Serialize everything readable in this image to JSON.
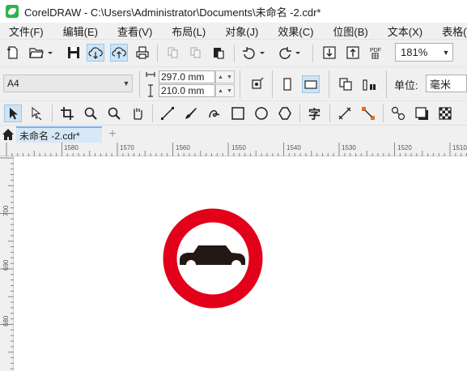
{
  "window": {
    "title": "CorelDRAW - C:\\Users\\Administrator\\Documents\\未命名 -2.cdr*"
  },
  "menu": [
    "文件(F)",
    "编辑(E)",
    "查看(V)",
    "布局(L)",
    "对象(J)",
    "效果(C)",
    "位图(B)",
    "文本(X)",
    "表格(T)"
  ],
  "standard_toolbar": {
    "zoom": "181%",
    "icons": [
      "new-document-icon",
      "open-folder-icon",
      "save-icon",
      "cloud-download-icon",
      "cloud-upload-icon",
      "print-icon",
      "cut-icon",
      "copy-icon",
      "paste-icon",
      "undo-icon",
      "redo-icon",
      "import-icon",
      "export-icon",
      "publish-pdf-icon"
    ]
  },
  "property_bar": {
    "page_size": "A4",
    "width": "297.0 mm",
    "height": "210.0 mm",
    "units_label": "单位:",
    "units": "毫米"
  },
  "toolbox_icons": [
    "pick-tool-icon",
    "shape-tool-icon",
    "crop-tool-icon",
    "zoom-tool-icon",
    "zoom-out-icon",
    "pan-hand-icon",
    "freehand-tool-icon",
    "artistic-media-icon",
    "bezier-spiral-icon",
    "rectangle-tool-icon",
    "ellipse-tool-icon",
    "polygon-tool-icon",
    "text-tool-icon",
    "parallel-dimension-icon",
    "connector-tool-icon",
    "blend-tool-icon",
    "drop-shadow-icon",
    "transparency-tool-icon"
  ],
  "tabs": {
    "document": "未命名 -2.cdr*",
    "add": "+"
  },
  "rulers": {
    "horizontal": [
      "1580",
      "1570",
      "1560",
      "1550",
      "1540",
      "1530",
      "1520",
      "1510"
    ],
    "vertical": [
      "700",
      "690",
      "680"
    ]
  },
  "colors": {
    "sign_ring": "#e2001a",
    "car": "#231815",
    "tab_active": "#d7e8f7"
  }
}
